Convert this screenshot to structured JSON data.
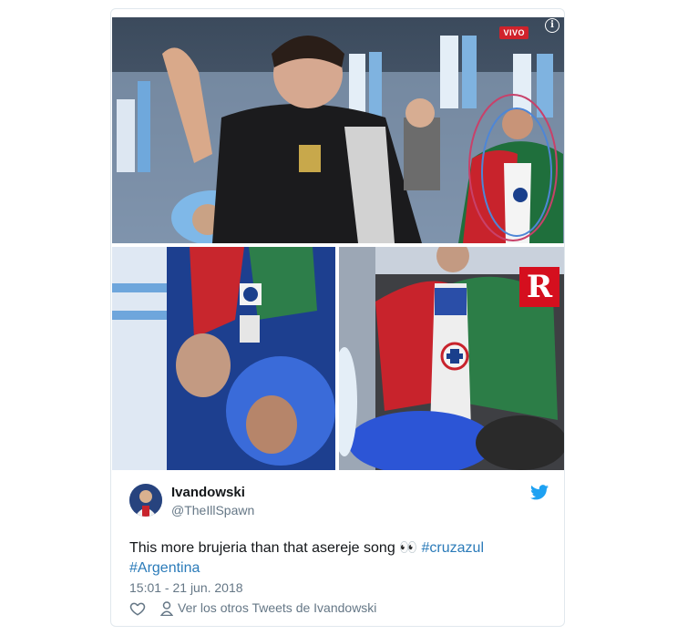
{
  "media": {
    "overlay_text": "VIVO",
    "info_icon_glyph": "i",
    "brand_letter": "R",
    "accent_circle_color": "#c8416a"
  },
  "tweet": {
    "display_name": "Ivandowski",
    "handle": "@TheIllSpawn",
    "text_main": "This more brujeria than that asereje song 👀 ",
    "hashtags": [
      "#cruzazul",
      "#Argentina"
    ],
    "timestamp": "15:01 - 21 jun. 2018",
    "view_more": "Ver los otros Tweets de Ivandowski"
  },
  "colors": {
    "twitter_blue": "#1da1f2",
    "link_blue": "#2b7bb9",
    "text": "#14171a",
    "secondary_text": "#657786",
    "border": "#e1e8ed"
  },
  "icons": [
    "info-icon",
    "twitter-bird-icon",
    "heart-icon",
    "person-icon"
  ]
}
